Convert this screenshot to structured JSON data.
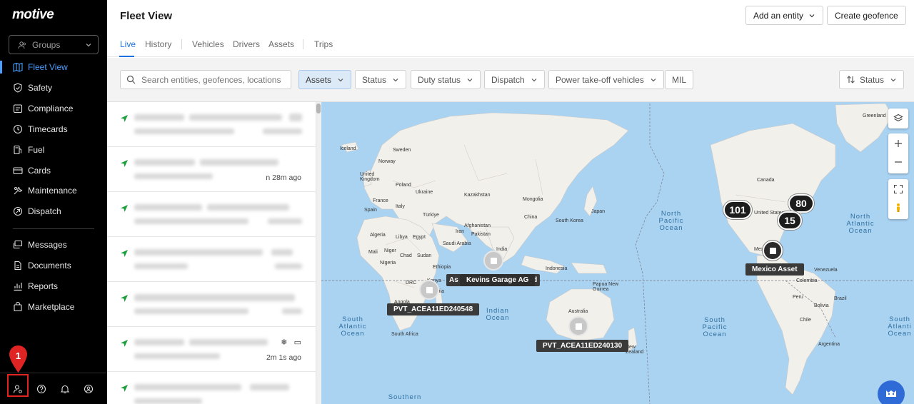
{
  "sidebar": {
    "logo": "motive",
    "groups_label": "Groups",
    "items": [
      {
        "label": "Fleet View",
        "icon": "map-icon"
      },
      {
        "label": "Safety",
        "icon": "shield-icon"
      },
      {
        "label": "Compliance",
        "icon": "clipboard-icon"
      },
      {
        "label": "Timecards",
        "icon": "clock-icon"
      },
      {
        "label": "Fuel",
        "icon": "fuel-icon"
      },
      {
        "label": "Cards",
        "icon": "card-icon"
      },
      {
        "label": "Maintenance",
        "icon": "wrench-icon"
      },
      {
        "label": "Dispatch",
        "icon": "dispatch-icon"
      },
      {
        "label": "Messages",
        "icon": "messages-icon"
      },
      {
        "label": "Documents",
        "icon": "document-icon"
      },
      {
        "label": "Reports",
        "icon": "reports-icon"
      },
      {
        "label": "Marketplace",
        "icon": "bag-icon"
      }
    ],
    "annotation_number": "1"
  },
  "header": {
    "title": "Fleet View",
    "add_entity": "Add an entity",
    "create_geofence": "Create geofence",
    "tabs": [
      "Live",
      "History",
      "Vehicles",
      "Drivers",
      "Assets",
      "Trips"
    ]
  },
  "filters": {
    "search_placeholder": "Search entities, geofences, locations",
    "buttons": [
      "Assets",
      "Status",
      "Duty status",
      "Dispatch",
      "Power take-off vehicles",
      "MIL"
    ],
    "sort_label": "Status"
  },
  "list": {
    "times": [
      "",
      "n 28m ago",
      "",
      "",
      "",
      "2m 1s ago",
      ""
    ]
  },
  "map": {
    "clusters": [
      "101",
      "80",
      "15"
    ],
    "tags": [
      "Kevins Garage AG",
      "As",
      "nd",
      "PVT_ACEA11ED240548",
      "PVT_ACEA11ED240130",
      "Mexico Asset"
    ],
    "oceans": {
      "north_pacific": "North\nPacific\nOcean",
      "north_atlantic": "North\nAtlantic\nOcean",
      "south_atlantic": "South\nAtlantic\nOcean",
      "indian": "Indian\nOcean",
      "south_pacific": "South\nPacific\nOcean",
      "south_atlantic_right": "South\nAtlanti\nOcean",
      "southern": "Southern"
    },
    "places": [
      "Greenland",
      "Iceland",
      "Sweden",
      "Norway",
      "United Kingdom",
      "Poland",
      "Ukraine",
      "Kazakhstan",
      "France",
      "Spain",
      "Italy",
      "Türkiye",
      "Mongolia",
      "China",
      "South Korea",
      "Japan",
      "Afghanistan",
      "Iran",
      "Pakistan",
      "India",
      "Algeria",
      "Libya",
      "Egypt",
      "Saudi Arabia",
      "Mali",
      "Niger",
      "Chad",
      "Sudan",
      "Nigeria",
      "Ethiopia",
      "Kenya",
      "DRC",
      "Tanzania",
      "Angola",
      "South Africa",
      "Indonesia",
      "Papua New Guinea",
      "Australia",
      "New Zealand",
      "Canada",
      "United States",
      "Mexico",
      "Venezuela",
      "Colombia",
      "Peru",
      "Brazil",
      "Bolivia",
      "Chile",
      "Argentina"
    ]
  }
}
